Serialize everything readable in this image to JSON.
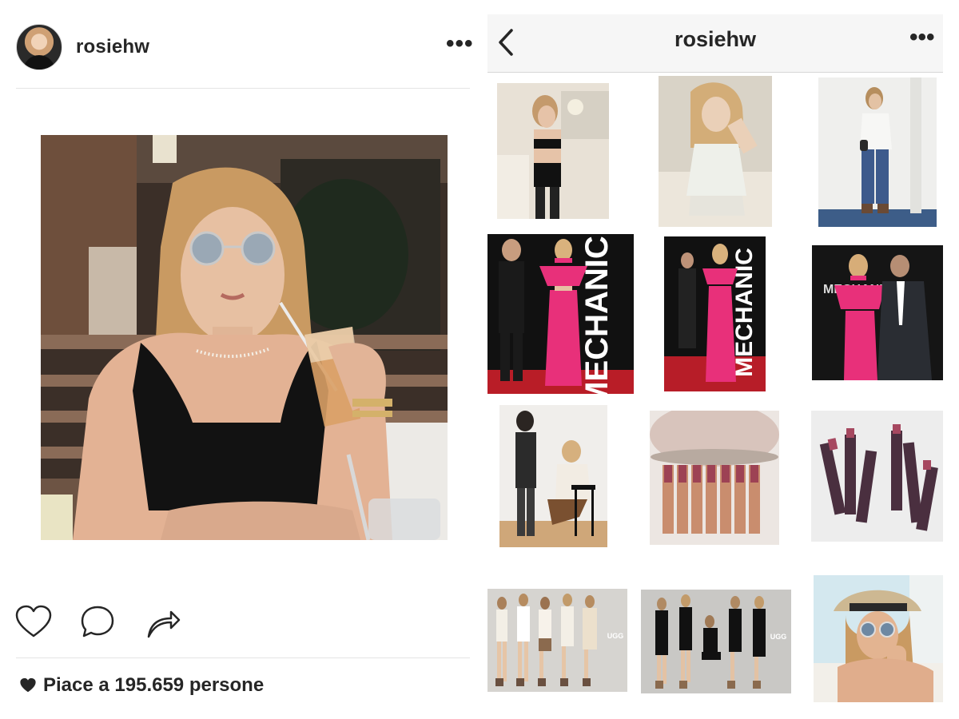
{
  "post": {
    "username": "rosiehw",
    "more_label": "•••",
    "likes_text": "Piace a 195.659 persone",
    "icons": {
      "like": "heart-outline-icon",
      "comment": "comment-bubble-icon",
      "share": "share-arrow-icon",
      "likes": "heart-filled-icon"
    }
  },
  "profile": {
    "title": "rosiehw",
    "more_label": "•••",
    "back_icon": "chevron-left-icon",
    "grid": [
      {
        "name": "lingerie-photo"
      },
      {
        "name": "satin-pajamas-photo"
      },
      {
        "name": "white-blouse-jeans-photo"
      },
      {
        "name": "pink-outfit-premiere-photo"
      },
      {
        "name": "red-carpet-pink-outfit-photo"
      },
      {
        "name": "premiere-couple-photo"
      },
      {
        "name": "makeup-session-photo"
      },
      {
        "name": "lipstick-lineup-photo"
      },
      {
        "name": "lipstick-collection-photo"
      },
      {
        "name": "ugg-campaign-light-photo",
        "logo_text": "UGG"
      },
      {
        "name": "ugg-campaign-dark-photo",
        "logo_text": "UGG"
      },
      {
        "name": "straw-hat-selfie-photo"
      }
    ],
    "banner_text": "MECHANIC"
  },
  "colors": {
    "text": "#262626",
    "divider": "#e4e4e4",
    "nav_bg": "#f6f6f6",
    "pink_outfit": "#e8307a",
    "black": "#111111"
  }
}
